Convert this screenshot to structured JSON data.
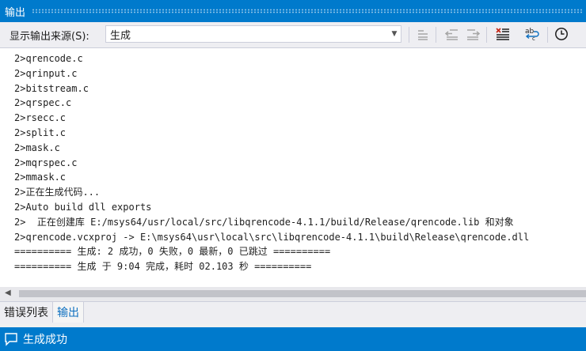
{
  "window": {
    "title": "输出"
  },
  "toolbar": {
    "source_label": "显示输出来源(S):",
    "source_value": "生成",
    "buttons": [
      {
        "name": "go-to-previous-message-button",
        "icon": "align-left-icon"
      },
      {
        "name": "scroll-left-button",
        "icon": "indent-left-icon"
      },
      {
        "name": "scroll-right-button",
        "icon": "indent-right-icon"
      },
      {
        "name": "clear-all-button",
        "icon": "clear-all-icon"
      },
      {
        "name": "toggle-word-wrap-button",
        "icon": "word-wrap-icon"
      },
      {
        "name": "toggle-timestamp-button",
        "icon": "clock-icon"
      }
    ]
  },
  "output": {
    "lines": [
      "2>qrencode.c",
      "2>qrinput.c",
      "2>bitstream.c",
      "2>qrspec.c",
      "2>rsecc.c",
      "2>split.c",
      "2>mask.c",
      "2>mqrspec.c",
      "2>mmask.c",
      "2>正在生成代码...",
      "2>Auto build dll exports",
      "2>  正在创建库 E:/msys64/usr/local/src/libqrencode-4.1.1/build/Release/qrencode.lib 和对象",
      "2>qrencode.vcxproj -> E:\\msys64\\usr\\local\\src\\libqrencode-4.1.1\\build\\Release\\qrencode.dll",
      "========== 生成: 2 成功，0 失败，0 最新，0 已跳过 ==========",
      "========== 生成 于 9:04 完成，耗时 02.103 秒 =========="
    ]
  },
  "tabs": [
    {
      "label": "错误列表",
      "active": false
    },
    {
      "label": "输出",
      "active": true
    }
  ],
  "status": {
    "text": "生成成功",
    "icon": "comment-icon"
  },
  "colors": {
    "accent": "#007acc",
    "tab_active_text": "#0e70c0",
    "clear_icon_red": "#c42b1c"
  }
}
